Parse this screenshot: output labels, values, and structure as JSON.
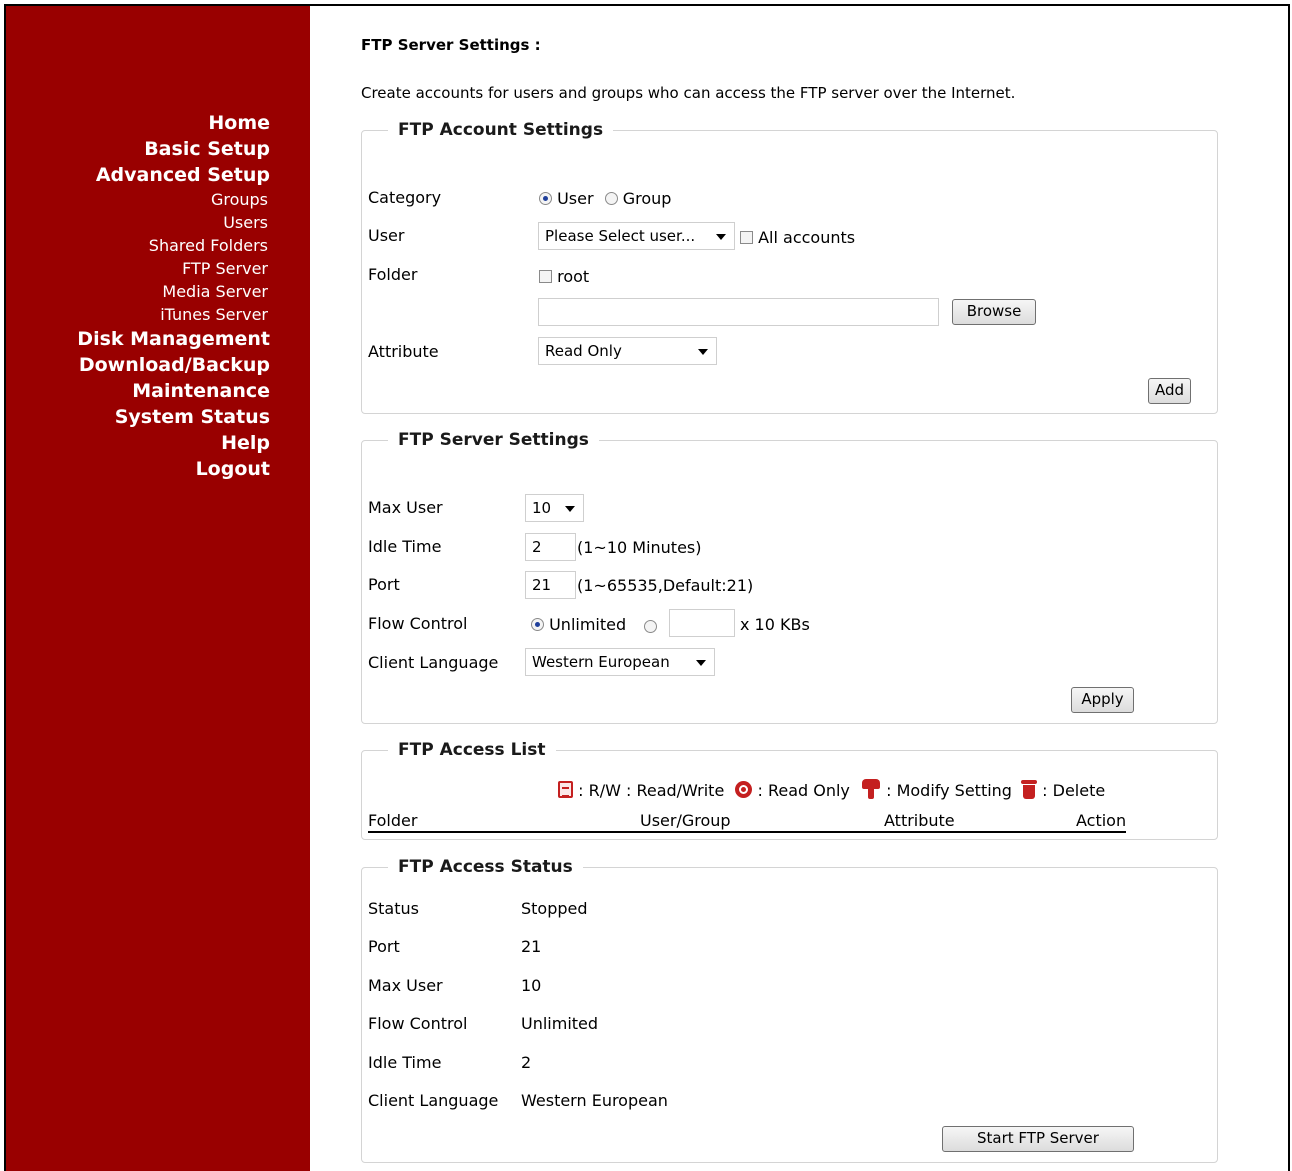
{
  "sidebar": {
    "home": "Home",
    "basic_setup": "Basic Setup",
    "advanced_setup": "Advanced Setup",
    "sub_items": [
      "Groups",
      "Users",
      "Shared Folders",
      "FTP Server",
      "Media Server",
      "iTunes Server"
    ],
    "disk_management": "Disk Management",
    "download_backup": "Download/Backup",
    "maintenance": "Maintenance",
    "system_status": "System Status",
    "help": "Help",
    "logout": "Logout"
  },
  "page": {
    "title": "FTP Server Settings :",
    "intro": "Create accounts for users and groups who can access the FTP server over the Internet."
  },
  "account_settings": {
    "legend": "FTP Account Settings",
    "category_label": "Category",
    "category_options": [
      "User",
      "Group"
    ],
    "category_selected": "User",
    "user_label": "User",
    "user_select": "Please Select user...",
    "all_accounts_label": "All accounts",
    "folder_label": "Folder",
    "root_label": "root",
    "folder_path": "",
    "browse_button": "Browse",
    "attribute_label": "Attribute",
    "attribute_select": "Read Only",
    "add_button": "Add"
  },
  "server_settings": {
    "legend": "FTP Server Settings",
    "max_user_label": "Max User",
    "max_user_value": "10",
    "idle_time_label": "Idle Time",
    "idle_time_value": "2",
    "idle_time_hint": "(1~10 Minutes)",
    "port_label": "Port",
    "port_value": "21",
    "port_hint": "(1~65535,Default:21)",
    "flow_control_label": "Flow Control",
    "flow_unlimited": "Unlimited",
    "flow_value": "",
    "flow_unit": "x 10 KBs",
    "client_language_label": "Client Language",
    "client_language_value": "Western European",
    "apply_button": "Apply"
  },
  "access_list": {
    "legend": "FTP Access List",
    "icons_legend": [
      {
        "icon": "read-write-icon",
        "text": ": R/W : Read/Write"
      },
      {
        "icon": "read-only-icon",
        "text": ": Read Only"
      },
      {
        "icon": "modify-setting-icon",
        "text": ": Modify Setting"
      },
      {
        "icon": "delete-icon",
        "text": ": Delete"
      }
    ],
    "columns": [
      "Folder",
      "User/Group",
      "Attribute",
      "Action"
    ],
    "rows": []
  },
  "access_status": {
    "legend": "FTP Access Status",
    "rows": [
      {
        "label": "Status",
        "value": "Stopped"
      },
      {
        "label": "Port",
        "value": "21"
      },
      {
        "label": "Max User",
        "value": "10"
      },
      {
        "label": "Flow Control",
        "value": "Unlimited"
      },
      {
        "label": "Idle Time",
        "value": "2"
      },
      {
        "label": "Client Language",
        "value": "Western European"
      }
    ],
    "start_button": "Start FTP Server"
  },
  "colors": {
    "sidebar_bg": "#990000",
    "icon_red": "#c42020"
  }
}
